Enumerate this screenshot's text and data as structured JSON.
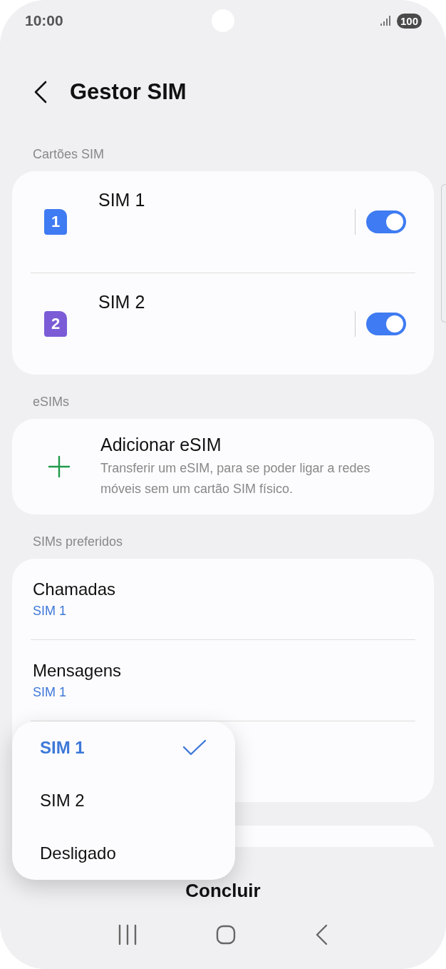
{
  "status_bar": {
    "time": "10:00",
    "battery": "100"
  },
  "header": {
    "title": "Gestor SIM"
  },
  "sections": [
    {
      "title": "Cartões SIM",
      "kind": "sim_cards",
      "items": [
        {
          "name": "SIM 1",
          "badge": "1",
          "color": "#3f7bf2",
          "on": true
        },
        {
          "name": "SIM 2",
          "badge": "2",
          "color": "#7b5cd6",
          "on": true
        }
      ]
    },
    {
      "title": "eSIMs",
      "kind": "action",
      "items": [
        {
          "title": "Adicionar eSIM",
          "description": "Transferir um eSIM, para se poder ligar a redes móveis sem um cartão SIM físico."
        }
      ]
    },
    {
      "title": "SIMs preferidos",
      "kind": "preferred",
      "items": [
        {
          "title": "Chamadas",
          "value": "SIM 1"
        },
        {
          "title": "Mensagens",
          "value": "SIM 1"
        }
      ]
    }
  ],
  "menu": {
    "options": [
      {
        "label": "SIM 1",
        "selected": true
      },
      {
        "label": "SIM 2",
        "selected": false
      },
      {
        "label": "Desligado",
        "selected": false
      }
    ]
  },
  "done_button": "Concluir"
}
